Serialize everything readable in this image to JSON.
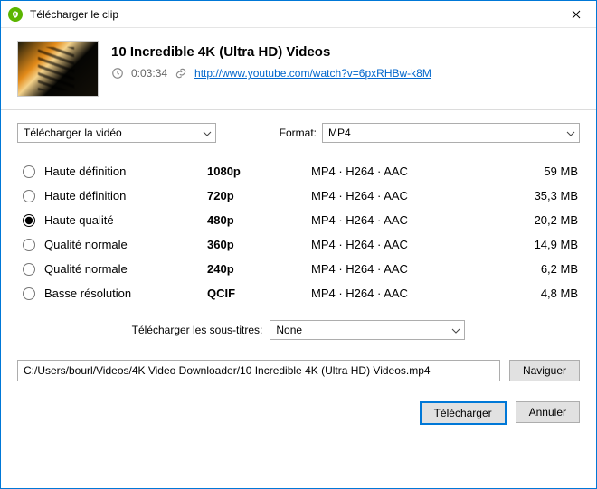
{
  "window": {
    "title": "Télécharger le clip"
  },
  "video": {
    "title": "10 Incredible 4K (Ultra HD) Videos",
    "duration": "0:03:34",
    "url": "http://www.youtube.com/watch?v=6pxRHBw-k8M"
  },
  "download_type": {
    "selected": "Télécharger la vidéo"
  },
  "format": {
    "label": "Format:",
    "selected": "MP4"
  },
  "qualities": [
    {
      "name": "Haute définition",
      "res": "1080p",
      "fmt": "MP4 · H264 · AAC",
      "size": "59 MB",
      "selected": false
    },
    {
      "name": "Haute définition",
      "res": "720p",
      "fmt": "MP4 · H264 · AAC",
      "size": "35,3 MB",
      "selected": false
    },
    {
      "name": "Haute qualité",
      "res": "480p",
      "fmt": "MP4 · H264 · AAC",
      "size": "20,2 MB",
      "selected": true
    },
    {
      "name": "Qualité normale",
      "res": "360p",
      "fmt": "MP4 · H264 · AAC",
      "size": "14,9 MB",
      "selected": false
    },
    {
      "name": "Qualité normale",
      "res": "240p",
      "fmt": "MP4 · H264 · AAC",
      "size": "6,2 MB",
      "selected": false
    },
    {
      "name": "Basse résolution",
      "res": "QCIF",
      "fmt": "MP4 · H264 · AAC",
      "size": "4,8 MB",
      "selected": false
    }
  ],
  "subtitles": {
    "label": "Télécharger les sous-titres:",
    "selected": "None"
  },
  "save_path": "C:/Users/bourl/Videos/4K Video Downloader/10 Incredible 4K (Ultra HD) Videos.mp4",
  "buttons": {
    "browse": "Naviguer",
    "download": "Télécharger",
    "cancel": "Annuler"
  }
}
